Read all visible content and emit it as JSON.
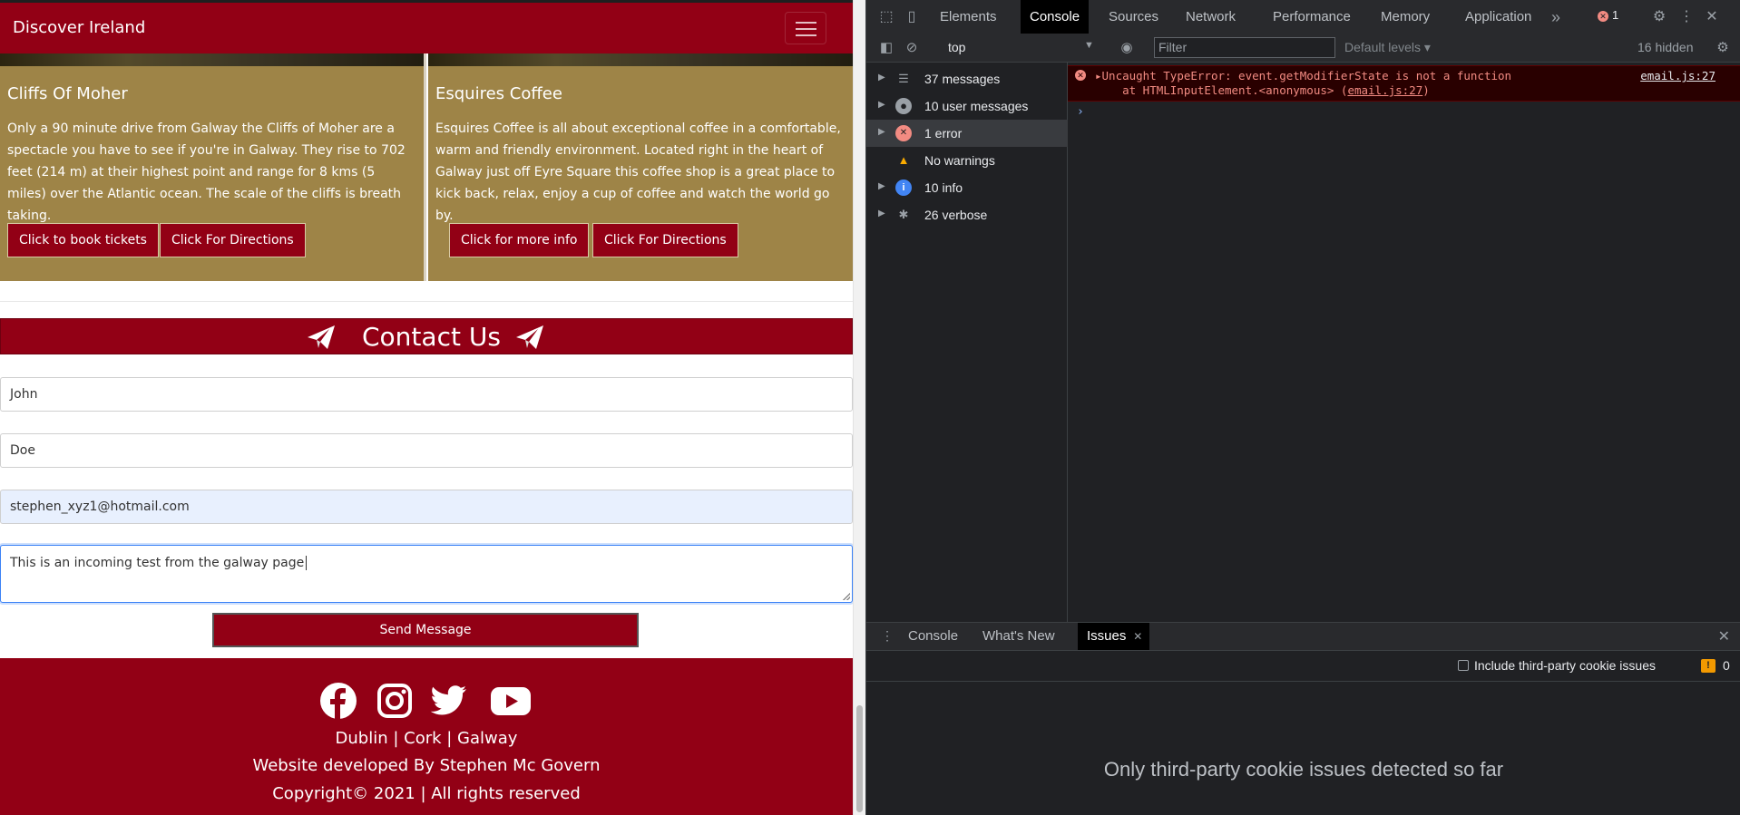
{
  "site": {
    "brand": "Discover Ireland",
    "cards": [
      {
        "title": "Cliffs Of Moher",
        "text": "Only a 90 minute drive from Galway the Cliffs of Moher are a spectacle you have to see if you're in Galway. They rise to 702 feet (214 m) at their highest point and range for 8 kms (5 miles) over the Atlantic ocean. The scale of the cliffs is breath taking.",
        "button1": "Click to book tickets",
        "button2": "Click For Directions"
      },
      {
        "title": "Esquires Coffee",
        "text": "Esquires Coffee is all about exceptional coffee in a comfortable, warm and friendly environment. Located right in the heart of Galway just off Eyre Square this coffee shop is a great place to kick back, relax, enjoy a cup of coffee and watch the world go by.",
        "button1": "Click for more info",
        "button2": "Click For Directions"
      }
    ],
    "contact": {
      "title": "Contact Us",
      "first_name": "John",
      "last_name": "Doe",
      "email": "stephen_xyz1@hotmail.com",
      "message": "This is an incoming test from the galway page",
      "send_label": "Send Message"
    },
    "footer": {
      "social_icons": [
        "facebook-icon",
        "instagram-icon",
        "twitter-icon",
        "youtube-icon"
      ],
      "cities": "Dublin | Cork | Galway",
      "credit": "Website developed By Stephen Mc Govern",
      "copyright": "Copyright© 2021 | All rights reserved"
    },
    "colors": {
      "brand": "#920015",
      "card": "#9e8447"
    }
  },
  "devtools": {
    "tabs": [
      "Elements",
      "Console",
      "Sources",
      "Network",
      "Performance",
      "Memory",
      "Application"
    ],
    "active_tab": "Console",
    "more_tabs": "»",
    "error_badge": "1",
    "context": "top",
    "filter_placeholder": "Filter",
    "levels": "Default levels ▾",
    "hidden_count": "16 hidden",
    "sidebar": [
      {
        "label": "37 messages",
        "icon": "list-icon"
      },
      {
        "label": "10 user messages",
        "icon": "user-icon"
      },
      {
        "label": "1 error",
        "icon": "error-icon"
      },
      {
        "label": "No warnings",
        "icon": "warning-icon"
      },
      {
        "label": "10 info",
        "icon": "info-icon"
      },
      {
        "label": "26 verbose",
        "icon": "bug-icon"
      }
    ],
    "error": {
      "line1": "Uncaught TypeError: event.getModifierState is not a function",
      "line2_prefix": "    at HTMLInputElement.<anonymous> (",
      "line2_link": "email.js:27",
      "line2_suffix": ")",
      "source": "email.js:27"
    },
    "prompt": "›",
    "drawer": {
      "tabs": [
        "Console",
        "What's New",
        "Issues"
      ],
      "active_tab": "Issues",
      "checkbox_label": "Include third-party cookie issues",
      "issue_count": "0",
      "message": "Only third-party cookie issues detected so far"
    },
    "colors": {
      "panel": "#202124",
      "error_text": "#f28b82"
    }
  }
}
